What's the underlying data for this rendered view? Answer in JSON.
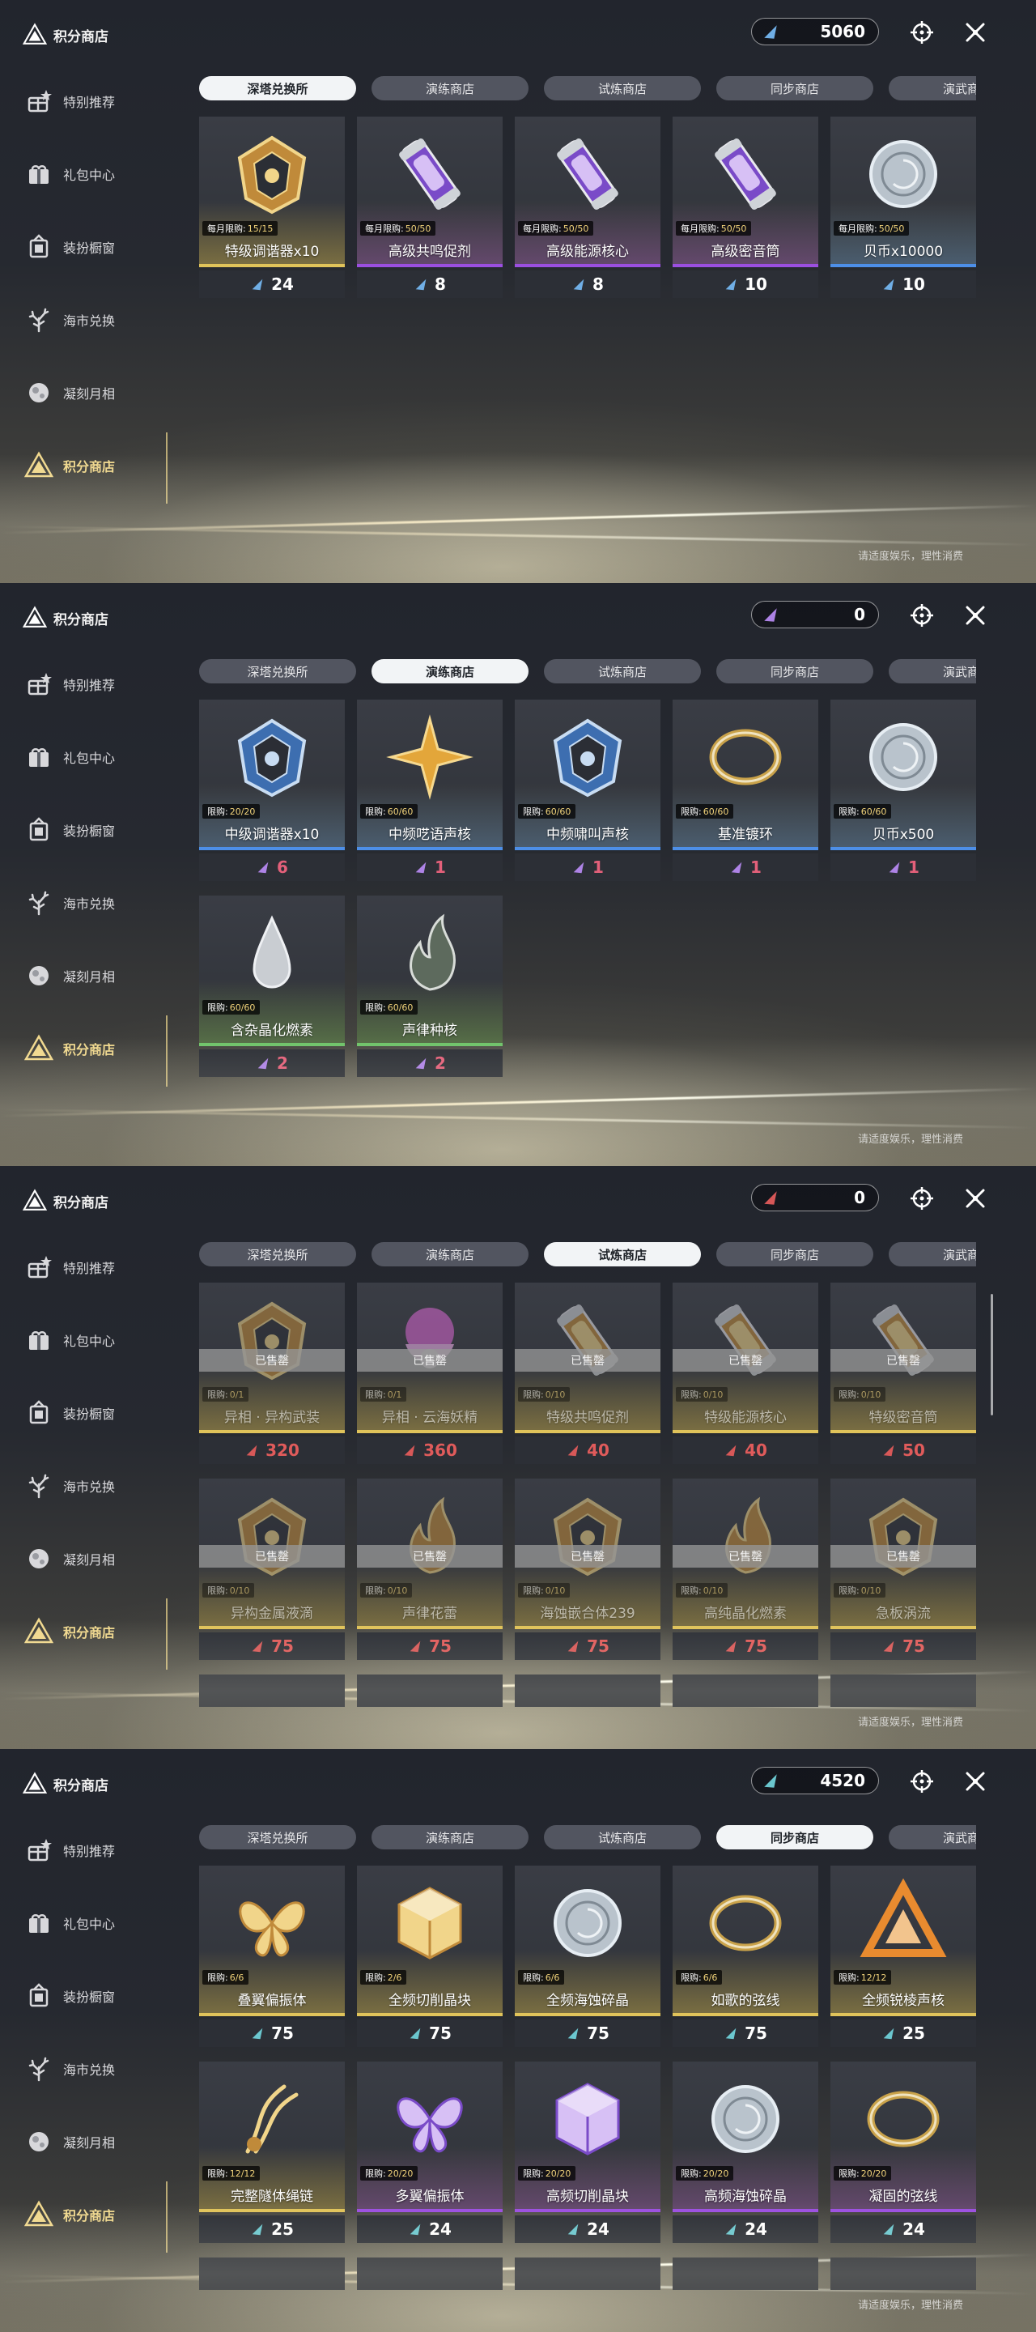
{
  "header": {
    "title": "积分商店"
  },
  "sidebar": {
    "items": [
      {
        "label": "特别推荐",
        "icon": "gift-star-icon"
      },
      {
        "label": "礼包中心",
        "icon": "gift-box-icon"
      },
      {
        "label": "装扮橱窗",
        "icon": "wardrobe-icon"
      },
      {
        "label": "海市兑换",
        "icon": "coral-icon"
      },
      {
        "label": "凝刻月相",
        "icon": "moon-icon"
      },
      {
        "label": "积分商店",
        "icon": "triangle-shop-icon",
        "active": true
      }
    ]
  },
  "tabs": [
    "深塔兑换所",
    "演练商店",
    "试炼商店",
    "同步商店",
    "演武商店"
  ],
  "footnote": "请适度娱乐，理性消费",
  "colors": {
    "accent_gold": "#f0d88e",
    "purple_rarity": "#9b4fe0",
    "gold_rarity": "#e0c35a",
    "blue_rarity": "#4d8fe8",
    "green_rarity": "#6fc36a",
    "currency_blue": "#74b6f0",
    "currency_purple": "#b588f0",
    "currency_red": "#e05b5b",
    "currency_teal": "#6fd0d8"
  },
  "panels": [
    {
      "active_tab": 0,
      "currency": {
        "value": "5060",
        "icon": "blue-triangle-icon",
        "color": "#74b6f0"
      },
      "items": [
        {
          "name": "特级调谐器x10",
          "limit_label": "每月限购:",
          "limit_count": "15/15",
          "price": "24",
          "rarity": "gold",
          "icon": "tuner-gold-icon"
        },
        {
          "name": "高级共鸣促剂",
          "limit_label": "每月限购:",
          "limit_count": "50/50",
          "price": "8",
          "rarity": "purple",
          "icon": "vial-icon"
        },
        {
          "name": "高级能源核心",
          "limit_label": "每月限购:",
          "limit_count": "50/50",
          "price": "8",
          "rarity": "purple",
          "icon": "energy-core-icon"
        },
        {
          "name": "高级密音筒",
          "limit_label": "每月限购:",
          "limit_count": "50/50",
          "price": "10",
          "rarity": "purple",
          "icon": "sound-tube-icon"
        },
        {
          "name": "贝币x10000",
          "limit_label": "每月限购:",
          "limit_count": "50/50",
          "price": "10",
          "rarity": "blue",
          "icon": "coin-icon"
        }
      ]
    },
    {
      "active_tab": 1,
      "currency": {
        "value": "0",
        "icon": "purple-triangle-icon",
        "color": "#b588f0"
      },
      "items": [
        {
          "name": "中级调谐器x10",
          "limit_label": "限购:",
          "limit_count": "20/20",
          "price": "6",
          "rarity": "blue",
          "icon": "tuner-blue-icon",
          "price_color": "pink"
        },
        {
          "name": "中频呓语声核",
          "limit_label": "限购:",
          "limit_count": "60/60",
          "price": "1",
          "rarity": "blue",
          "icon": "star-core-icon",
          "price_color": "pink"
        },
        {
          "name": "中频啸叫声核",
          "limit_label": "限购:",
          "limit_count": "60/60",
          "price": "1",
          "rarity": "blue",
          "icon": "howl-core-icon",
          "price_color": "pink"
        },
        {
          "name": "基准镀环",
          "limit_label": "限购:",
          "limit_count": "60/60",
          "price": "1",
          "rarity": "blue",
          "icon": "ring-icon",
          "price_color": "pink"
        },
        {
          "name": "贝币x500",
          "limit_label": "限购:",
          "limit_count": "60/60",
          "price": "1",
          "rarity": "blue",
          "icon": "coin-icon",
          "price_color": "pink"
        },
        {
          "name": "含杂晶化燃素",
          "limit_label": "限购:",
          "limit_count": "60/60",
          "price": "2",
          "rarity": "green",
          "icon": "droplet-icon",
          "price_color": "pink"
        },
        {
          "name": "声律种核",
          "limit_label": "限购:",
          "limit_count": "60/60",
          "price": "2",
          "rarity": "green",
          "icon": "seed-core-icon",
          "price_color": "pink"
        }
      ]
    },
    {
      "active_tab": 2,
      "currency": {
        "value": "0",
        "icon": "red-triangle-icon",
        "color": "#e05b5b"
      },
      "sold_label": "已售罄",
      "items": [
        {
          "name": "异相 · 异构武装",
          "limit_label": "限购:",
          "limit_count": "0/1",
          "price": "320",
          "rarity": "gold",
          "icon": "armor-icon",
          "sold": true
        },
        {
          "name": "异相 · 云海妖精",
          "limit_label": "限购:",
          "limit_count": "0/1",
          "price": "360",
          "rarity": "gold",
          "icon": "fairy-icon",
          "sold": true
        },
        {
          "name": "特级共鸣促剂",
          "limit_label": "限购:",
          "limit_count": "0/10",
          "price": "40",
          "rarity": "gold",
          "icon": "vial-icon",
          "sold": true
        },
        {
          "name": "特级能源核心",
          "limit_label": "限购:",
          "limit_count": "0/10",
          "price": "40",
          "rarity": "gold",
          "icon": "energy-core-icon",
          "sold": true
        },
        {
          "name": "特级密音筒",
          "limit_label": "限购:",
          "limit_count": "0/10",
          "price": "50",
          "rarity": "gold",
          "icon": "sound-tube-icon",
          "sold": true
        },
        {
          "name": "异构金属液滴",
          "limit_label": "限购:",
          "limit_count": "0/10",
          "price": "75",
          "rarity": "gold",
          "icon": "metal-drop-icon",
          "sold": true
        },
        {
          "name": "声律花蕾",
          "limit_label": "限购:",
          "limit_count": "0/10",
          "price": "75",
          "rarity": "gold",
          "icon": "bud-icon",
          "sold": true
        },
        {
          "name": "海蚀嵌合体239",
          "limit_label": "限购:",
          "limit_count": "0/10",
          "price": "75",
          "rarity": "gold",
          "icon": "chimera-icon",
          "sold": true
        },
        {
          "name": "高纯晶化燃素",
          "limit_label": "限购:",
          "limit_count": "0/10",
          "price": "75",
          "rarity": "gold",
          "icon": "flame-icon",
          "sold": true
        },
        {
          "name": "急板涡流",
          "limit_label": "限购:",
          "limit_count": "0/10",
          "price": "75",
          "rarity": "gold",
          "icon": "vortex-icon",
          "sold": true
        }
      ]
    },
    {
      "active_tab": 3,
      "currency": {
        "value": "4520",
        "icon": "teal-triangle-icon",
        "color": "#6fd0d8"
      },
      "items": [
        {
          "name": "叠翼偏振体",
          "limit_label": "限购:",
          "limit_count": "6/6",
          "price": "75",
          "rarity": "gold",
          "icon": "butterfly-icon"
        },
        {
          "name": "全频切削晶块",
          "limit_label": "限购:",
          "limit_count": "2/6",
          "price": "75",
          "rarity": "gold",
          "icon": "crystal-cube-icon"
        },
        {
          "name": "全频海蚀碎晶",
          "limit_label": "限购:",
          "limit_count": "6/6",
          "price": "75",
          "rarity": "gold",
          "icon": "shard-disc-icon"
        },
        {
          "name": "如歌的弦线",
          "limit_label": "限购:",
          "limit_count": "6/6",
          "price": "75",
          "rarity": "gold",
          "icon": "string-icon"
        },
        {
          "name": "全频锐棱声核",
          "limit_label": "限购:",
          "limit_count": "12/12",
          "price": "25",
          "rarity": "gold",
          "icon": "prism-core-icon"
        },
        {
          "name": "完整隧体绳链",
          "limit_label": "限购:",
          "limit_count": "12/12",
          "price": "25",
          "rarity": "gold",
          "icon": "chain-icon"
        },
        {
          "name": "多翼偏振体",
          "limit_label": "限购:",
          "limit_count": "20/20",
          "price": "24",
          "rarity": "purple",
          "icon": "butterfly-icon"
        },
        {
          "name": "高频切削晶块",
          "limit_label": "限购:",
          "limit_count": "20/20",
          "price": "24",
          "rarity": "purple",
          "icon": "crystal-cube-icon"
        },
        {
          "name": "高频海蚀碎晶",
          "limit_label": "限购:",
          "limit_count": "20/20",
          "price": "24",
          "rarity": "purple",
          "icon": "shard-disc-icon"
        },
        {
          "name": "凝固的弦线",
          "limit_label": "限购:",
          "limit_count": "20/20",
          "price": "24",
          "rarity": "purple",
          "icon": "string-icon"
        }
      ]
    }
  ]
}
